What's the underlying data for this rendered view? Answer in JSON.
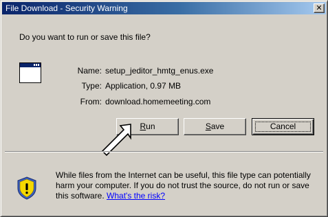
{
  "window": {
    "title": "File Download - Security Warning",
    "close_glyph": "✕"
  },
  "prompt": {
    "question": "Do you want to run or save this file?"
  },
  "file": {
    "icon": "application-window-icon",
    "name_label": "Name:",
    "name_value": "setup_jeditor_hmtg_enus.exe",
    "type_label": "Type:",
    "type_value": "Application, 0.97 MB",
    "from_label": "From:",
    "from_value": "download.homemeeting.com"
  },
  "buttons": {
    "run_accel": "R",
    "run_rest": "un",
    "save_accel": "S",
    "save_rest": "ave",
    "cancel_label": "Cancel"
  },
  "warning": {
    "icon": "shield-warning-icon",
    "text": "While files from the Internet can be useful, this file type can potentially harm your computer. If you do not trust the source, do not run or save this software. ",
    "link_text": "What's the risk?"
  },
  "colors": {
    "titlebar_start": "#0a246a",
    "titlebar_end": "#a6caf0",
    "dialog_face": "#d4d0c8",
    "link": "#0000ff",
    "shield_yellow": "#f5d800",
    "shield_blue": "#3b5fc0"
  }
}
